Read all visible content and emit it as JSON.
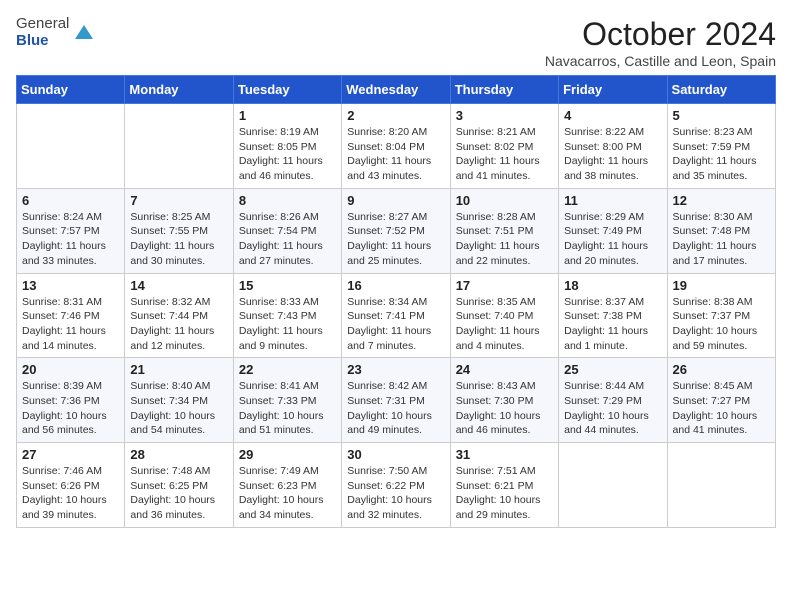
{
  "header": {
    "logo": {
      "general": "General",
      "blue": "Blue"
    },
    "title": "October 2024",
    "subtitle": "Navacarros, Castille and Leon, Spain"
  },
  "weekdays": [
    "Sunday",
    "Monday",
    "Tuesday",
    "Wednesday",
    "Thursday",
    "Friday",
    "Saturday"
  ],
  "weeks": [
    [
      null,
      null,
      {
        "day": 1,
        "sunrise": "8:19 AM",
        "sunset": "8:05 PM",
        "daylight": "11 hours and 46 minutes."
      },
      {
        "day": 2,
        "sunrise": "8:20 AM",
        "sunset": "8:04 PM",
        "daylight": "11 hours and 43 minutes."
      },
      {
        "day": 3,
        "sunrise": "8:21 AM",
        "sunset": "8:02 PM",
        "daylight": "11 hours and 41 minutes."
      },
      {
        "day": 4,
        "sunrise": "8:22 AM",
        "sunset": "8:00 PM",
        "daylight": "11 hours and 38 minutes."
      },
      {
        "day": 5,
        "sunrise": "8:23 AM",
        "sunset": "7:59 PM",
        "daylight": "11 hours and 35 minutes."
      }
    ],
    [
      {
        "day": 6,
        "sunrise": "8:24 AM",
        "sunset": "7:57 PM",
        "daylight": "11 hours and 33 minutes."
      },
      {
        "day": 7,
        "sunrise": "8:25 AM",
        "sunset": "7:55 PM",
        "daylight": "11 hours and 30 minutes."
      },
      {
        "day": 8,
        "sunrise": "8:26 AM",
        "sunset": "7:54 PM",
        "daylight": "11 hours and 27 minutes."
      },
      {
        "day": 9,
        "sunrise": "8:27 AM",
        "sunset": "7:52 PM",
        "daylight": "11 hours and 25 minutes."
      },
      {
        "day": 10,
        "sunrise": "8:28 AM",
        "sunset": "7:51 PM",
        "daylight": "11 hours and 22 minutes."
      },
      {
        "day": 11,
        "sunrise": "8:29 AM",
        "sunset": "7:49 PM",
        "daylight": "11 hours and 20 minutes."
      },
      {
        "day": 12,
        "sunrise": "8:30 AM",
        "sunset": "7:48 PM",
        "daylight": "11 hours and 17 minutes."
      }
    ],
    [
      {
        "day": 13,
        "sunrise": "8:31 AM",
        "sunset": "7:46 PM",
        "daylight": "11 hours and 14 minutes."
      },
      {
        "day": 14,
        "sunrise": "8:32 AM",
        "sunset": "7:44 PM",
        "daylight": "11 hours and 12 minutes."
      },
      {
        "day": 15,
        "sunrise": "8:33 AM",
        "sunset": "7:43 PM",
        "daylight": "11 hours and 9 minutes."
      },
      {
        "day": 16,
        "sunrise": "8:34 AM",
        "sunset": "7:41 PM",
        "daylight": "11 hours and 7 minutes."
      },
      {
        "day": 17,
        "sunrise": "8:35 AM",
        "sunset": "7:40 PM",
        "daylight": "11 hours and 4 minutes."
      },
      {
        "day": 18,
        "sunrise": "8:37 AM",
        "sunset": "7:38 PM",
        "daylight": "11 hours and 1 minute."
      },
      {
        "day": 19,
        "sunrise": "8:38 AM",
        "sunset": "7:37 PM",
        "daylight": "10 hours and 59 minutes."
      }
    ],
    [
      {
        "day": 20,
        "sunrise": "8:39 AM",
        "sunset": "7:36 PM",
        "daylight": "10 hours and 56 minutes."
      },
      {
        "day": 21,
        "sunrise": "8:40 AM",
        "sunset": "7:34 PM",
        "daylight": "10 hours and 54 minutes."
      },
      {
        "day": 22,
        "sunrise": "8:41 AM",
        "sunset": "7:33 PM",
        "daylight": "10 hours and 51 minutes."
      },
      {
        "day": 23,
        "sunrise": "8:42 AM",
        "sunset": "7:31 PM",
        "daylight": "10 hours and 49 minutes."
      },
      {
        "day": 24,
        "sunrise": "8:43 AM",
        "sunset": "7:30 PM",
        "daylight": "10 hours and 46 minutes."
      },
      {
        "day": 25,
        "sunrise": "8:44 AM",
        "sunset": "7:29 PM",
        "daylight": "10 hours and 44 minutes."
      },
      {
        "day": 26,
        "sunrise": "8:45 AM",
        "sunset": "7:27 PM",
        "daylight": "10 hours and 41 minutes."
      }
    ],
    [
      {
        "day": 27,
        "sunrise": "7:46 AM",
        "sunset": "6:26 PM",
        "daylight": "10 hours and 39 minutes."
      },
      {
        "day": 28,
        "sunrise": "7:48 AM",
        "sunset": "6:25 PM",
        "daylight": "10 hours and 36 minutes."
      },
      {
        "day": 29,
        "sunrise": "7:49 AM",
        "sunset": "6:23 PM",
        "daylight": "10 hours and 34 minutes."
      },
      {
        "day": 30,
        "sunrise": "7:50 AM",
        "sunset": "6:22 PM",
        "daylight": "10 hours and 32 minutes."
      },
      {
        "day": 31,
        "sunrise": "7:51 AM",
        "sunset": "6:21 PM",
        "daylight": "10 hours and 29 minutes."
      },
      null,
      null
    ]
  ]
}
